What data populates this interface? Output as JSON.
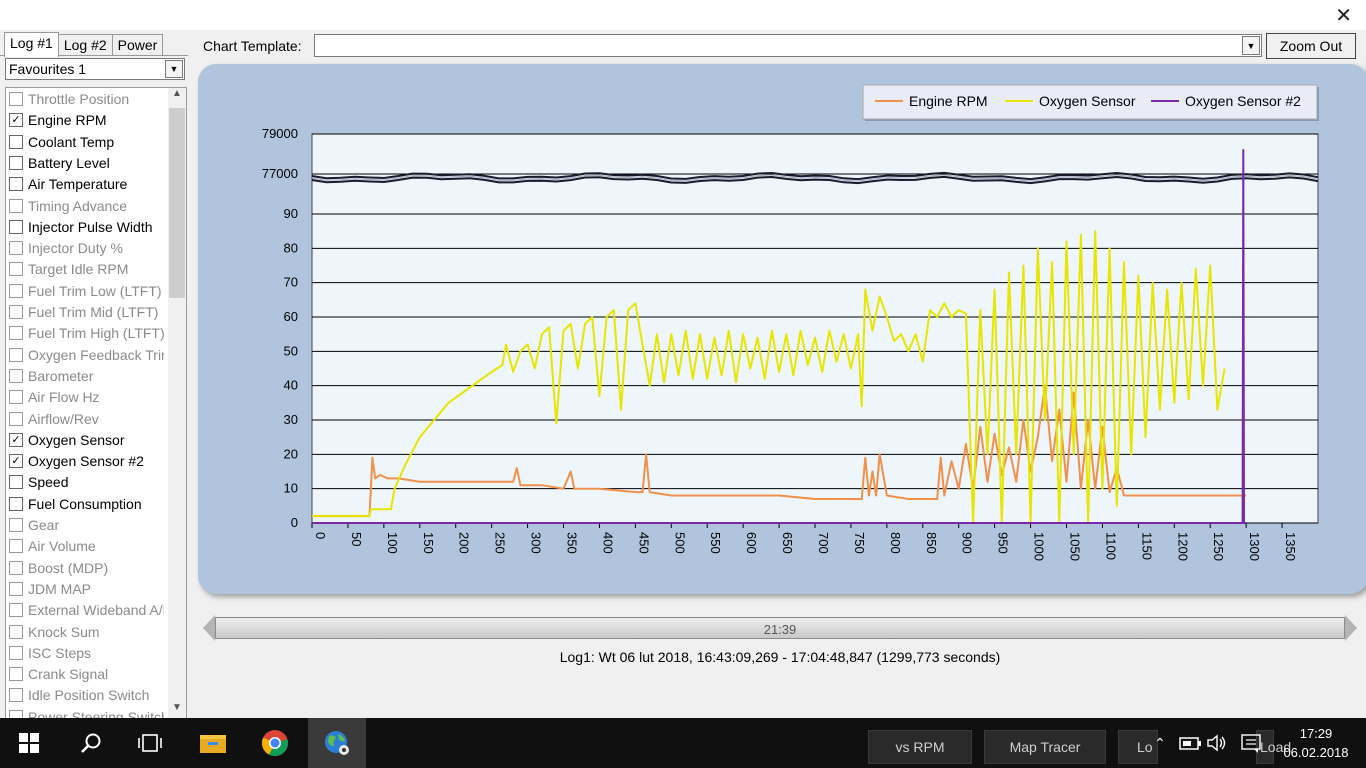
{
  "window": {
    "close_glyph": "✕"
  },
  "left_panel": {
    "tabs": [
      "Log #1",
      "Log #2",
      "Power"
    ],
    "favourites_value": "Favourites 1",
    "params": [
      {
        "label": "Throttle Position",
        "checked": false,
        "enabled": false
      },
      {
        "label": "Engine RPM",
        "checked": true,
        "enabled": true
      },
      {
        "label": "Coolant Temp",
        "checked": false,
        "enabled": true
      },
      {
        "label": "Battery Level",
        "checked": false,
        "enabled": true
      },
      {
        "label": "Air Temperature",
        "checked": false,
        "enabled": true
      },
      {
        "label": "Timing Advance",
        "checked": false,
        "enabled": false
      },
      {
        "label": "Injector Pulse Width",
        "checked": false,
        "enabled": true
      },
      {
        "label": "Injector Duty %",
        "checked": false,
        "enabled": false
      },
      {
        "label": "Target Idle RPM",
        "checked": false,
        "enabled": false
      },
      {
        "label": "Fuel Trim Low (LTFT)",
        "checked": false,
        "enabled": false
      },
      {
        "label": "Fuel Trim Mid (LTFT)",
        "checked": false,
        "enabled": false
      },
      {
        "label": "Fuel Trim High (LTFT)",
        "checked": false,
        "enabled": false
      },
      {
        "label": "Oxygen Feedback Trim",
        "checked": false,
        "enabled": false
      },
      {
        "label": "Barometer",
        "checked": false,
        "enabled": false
      },
      {
        "label": "Air Flow Hz",
        "checked": false,
        "enabled": false
      },
      {
        "label": "Airflow/Rev",
        "checked": false,
        "enabled": false
      },
      {
        "label": "Oxygen Sensor",
        "checked": true,
        "enabled": true
      },
      {
        "label": "Oxygen Sensor #2",
        "checked": true,
        "enabled": true
      },
      {
        "label": "Speed",
        "checked": false,
        "enabled": true
      },
      {
        "label": "Fuel Consumption",
        "checked": false,
        "enabled": true
      },
      {
        "label": "Gear",
        "checked": false,
        "enabled": false
      },
      {
        "label": "Air Volume",
        "checked": false,
        "enabled": false
      },
      {
        "label": "Boost (MDP)",
        "checked": false,
        "enabled": false
      },
      {
        "label": "JDM MAP",
        "checked": false,
        "enabled": false
      },
      {
        "label": "External Wideband A/F",
        "checked": false,
        "enabled": false
      },
      {
        "label": "Knock Sum",
        "checked": false,
        "enabled": false
      },
      {
        "label": "ISC Steps",
        "checked": false,
        "enabled": false
      },
      {
        "label": "Crank Signal",
        "checked": false,
        "enabled": false
      },
      {
        "label": "Idle Position Switch",
        "checked": false,
        "enabled": false
      },
      {
        "label": "Power Steering Switch",
        "checked": false,
        "enabled": false
      }
    ]
  },
  "toolbar": {
    "chart_template_label": "Chart Template:",
    "chart_template_value": "",
    "zoom_out_label": "Zoom Out"
  },
  "chart_data": {
    "type": "line",
    "x_ticks": [
      0,
      50,
      100,
      150,
      200,
      250,
      300,
      350,
      400,
      450,
      500,
      550,
      600,
      650,
      700,
      750,
      800,
      850,
      900,
      950,
      1000,
      1050,
      1100,
      1150,
      1200,
      1250,
      1300,
      1350
    ],
    "xlim": [
      0,
      1400
    ],
    "y_ticks_lower": [
      0,
      10,
      20,
      30,
      40,
      50,
      60,
      70,
      80,
      90
    ],
    "y_ticks_upper": [
      77000,
      79000
    ],
    "ylim": [
      0,
      100
    ],
    "legend_position": "top-right",
    "grid": true,
    "series": [
      {
        "name": "Engine RPM",
        "color": "#f0904a",
        "points": [
          [
            0,
            2
          ],
          [
            80,
            2
          ],
          [
            84,
            19
          ],
          [
            88,
            13
          ],
          [
            95,
            14
          ],
          [
            105,
            13
          ],
          [
            120,
            13
          ],
          [
            150,
            12
          ],
          [
            200,
            12
          ],
          [
            250,
            12
          ],
          [
            280,
            12
          ],
          [
            285,
            16
          ],
          [
            290,
            11
          ],
          [
            320,
            11
          ],
          [
            350,
            10
          ],
          [
            360,
            15
          ],
          [
            365,
            10
          ],
          [
            400,
            10
          ],
          [
            450,
            9
          ],
          [
            460,
            9
          ],
          [
            465,
            20
          ],
          [
            470,
            9
          ],
          [
            500,
            8
          ],
          [
            550,
            8
          ],
          [
            600,
            8
          ],
          [
            650,
            8
          ],
          [
            700,
            7
          ],
          [
            750,
            7
          ],
          [
            765,
            7
          ],
          [
            770,
            19
          ],
          [
            775,
            8
          ],
          [
            780,
            15
          ],
          [
            785,
            8
          ],
          [
            790,
            20
          ],
          [
            800,
            8
          ],
          [
            830,
            7
          ],
          [
            860,
            7
          ],
          [
            870,
            7
          ],
          [
            875,
            19
          ],
          [
            880,
            8
          ],
          [
            890,
            18
          ],
          [
            900,
            10
          ],
          [
            910,
            23
          ],
          [
            920,
            10
          ],
          [
            930,
            28
          ],
          [
            940,
            12
          ],
          [
            950,
            26
          ],
          [
            960,
            14
          ],
          [
            970,
            22
          ],
          [
            980,
            12
          ],
          [
            990,
            30
          ],
          [
            1000,
            15
          ],
          [
            1010,
            25
          ],
          [
            1020,
            40
          ],
          [
            1030,
            18
          ],
          [
            1040,
            33
          ],
          [
            1050,
            12
          ],
          [
            1060,
            38
          ],
          [
            1070,
            10
          ],
          [
            1080,
            30
          ],
          [
            1090,
            10
          ],
          [
            1100,
            28
          ],
          [
            1110,
            9
          ],
          [
            1120,
            16
          ],
          [
            1130,
            8
          ],
          [
            1150,
            8
          ],
          [
            1200,
            8
          ],
          [
            1250,
            8
          ],
          [
            1300,
            8
          ]
        ]
      },
      {
        "name": "Oxygen Sensor",
        "color": "#e6e600",
        "points": [
          [
            0,
            2
          ],
          [
            80,
            2
          ],
          [
            82,
            4
          ],
          [
            110,
            4
          ],
          [
            115,
            10
          ],
          [
            130,
            17
          ],
          [
            150,
            25
          ],
          [
            170,
            30
          ],
          [
            190,
            35
          ],
          [
            210,
            38
          ],
          [
            230,
            41
          ],
          [
            250,
            44
          ],
          [
            265,
            46
          ],
          [
            270,
            52
          ],
          [
            280,
            44
          ],
          [
            290,
            50
          ],
          [
            300,
            52
          ],
          [
            310,
            45
          ],
          [
            320,
            55
          ],
          [
            330,
            57
          ],
          [
            340,
            29
          ],
          [
            350,
            56
          ],
          [
            360,
            58
          ],
          [
            370,
            45
          ],
          [
            380,
            58
          ],
          [
            390,
            60
          ],
          [
            400,
            37
          ],
          [
            410,
            60
          ],
          [
            420,
            62
          ],
          [
            430,
            33
          ],
          [
            440,
            62
          ],
          [
            450,
            64
          ],
          [
            460,
            52
          ],
          [
            470,
            40
          ],
          [
            480,
            55
          ],
          [
            490,
            41
          ],
          [
            500,
            55
          ],
          [
            510,
            43
          ],
          [
            520,
            56
          ],
          [
            530,
            42
          ],
          [
            540,
            55
          ],
          [
            550,
            42
          ],
          [
            560,
            54
          ],
          [
            570,
            43
          ],
          [
            580,
            56
          ],
          [
            590,
            41
          ],
          [
            600,
            55
          ],
          [
            610,
            45
          ],
          [
            620,
            54
          ],
          [
            630,
            42
          ],
          [
            640,
            56
          ],
          [
            650,
            44
          ],
          [
            660,
            55
          ],
          [
            670,
            43
          ],
          [
            680,
            56
          ],
          [
            690,
            46
          ],
          [
            700,
            54
          ],
          [
            710,
            44
          ],
          [
            720,
            56
          ],
          [
            730,
            47
          ],
          [
            740,
            55
          ],
          [
            750,
            45
          ],
          [
            760,
            55
          ],
          [
            765,
            34
          ],
          [
            770,
            68
          ],
          [
            780,
            56
          ],
          [
            790,
            66
          ],
          [
            800,
            60
          ],
          [
            810,
            53
          ],
          [
            820,
            55
          ],
          [
            830,
            50
          ],
          [
            840,
            55
          ],
          [
            850,
            47
          ],
          [
            860,
            62
          ],
          [
            870,
            60
          ],
          [
            880,
            64
          ],
          [
            890,
            60
          ],
          [
            900,
            62
          ],
          [
            910,
            61
          ],
          [
            920,
            0
          ],
          [
            930,
            62
          ],
          [
            940,
            20
          ],
          [
            950,
            68
          ],
          [
            960,
            0
          ],
          [
            970,
            73
          ],
          [
            980,
            20
          ],
          [
            990,
            75
          ],
          [
            1000,
            0
          ],
          [
            1010,
            80
          ],
          [
            1020,
            30
          ],
          [
            1030,
            76
          ],
          [
            1040,
            0
          ],
          [
            1050,
            82
          ],
          [
            1060,
            20
          ],
          [
            1070,
            84
          ],
          [
            1080,
            0
          ],
          [
            1090,
            85
          ],
          [
            1100,
            10
          ],
          [
            1110,
            80
          ],
          [
            1120,
            5
          ],
          [
            1130,
            76
          ],
          [
            1140,
            20
          ],
          [
            1150,
            72
          ],
          [
            1160,
            25
          ],
          [
            1170,
            70
          ],
          [
            1180,
            33
          ],
          [
            1190,
            68
          ],
          [
            1200,
            35
          ],
          [
            1210,
            70
          ],
          [
            1220,
            36
          ],
          [
            1230,
            74
          ],
          [
            1240,
            40
          ],
          [
            1250,
            75
          ],
          [
            1260,
            33
          ],
          [
            1270,
            45
          ]
        ]
      },
      {
        "name": "Oxygen Sensor #2",
        "color": "#7a2aa8",
        "points": [
          [
            0,
            0
          ],
          [
            1290,
            0
          ],
          [
            1295,
            0
          ],
          [
            1296,
            108
          ],
          [
            1297,
            0
          ],
          [
            1300,
            0
          ]
        ]
      }
    ],
    "upper_band_label_value": 77000
  },
  "slider": {
    "time_label": "21:39"
  },
  "log_info": "Log1: Wt 06 lut 2018,   16:43:09,269 - 17:04:48,847 (1299,773 seconds)",
  "taskbar": {
    "buttons": [
      {
        "name": "start",
        "icon": "windows-icon"
      },
      {
        "name": "search",
        "icon": "search-icon"
      },
      {
        "name": "task-view",
        "icon": "task-view-icon"
      },
      {
        "name": "explorer",
        "icon": "folder-icon"
      },
      {
        "name": "chrome",
        "icon": "chrome-icon"
      },
      {
        "name": "app",
        "icon": "globe-icon"
      }
    ],
    "hidden_buttons": [
      "vs RPM",
      "Map Tracer",
      "Lo",
      "Load"
    ],
    "clock_time": "17:29",
    "clock_date": "06.02.2018"
  }
}
